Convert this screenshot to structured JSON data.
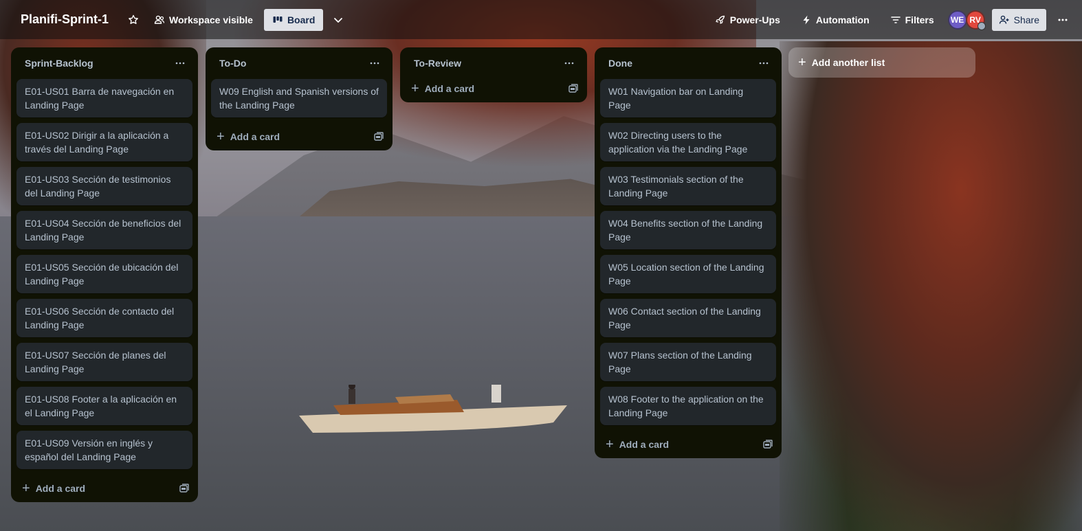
{
  "board": {
    "title": "Planifi-Sprint-1",
    "visibility_label": "Workspace visible",
    "view_label": "Board"
  },
  "topbar": {
    "power_ups_label": "Power-Ups",
    "automation_label": "Automation",
    "filters_label": "Filters",
    "share_label": "Share",
    "members": [
      {
        "initials": "WE",
        "color": "#6e5dc6"
      },
      {
        "initials": "RV",
        "color": "#e2483d"
      }
    ]
  },
  "lists": [
    {
      "title": "Sprint-Backlog",
      "cards": [
        "E01-US01 Barra de navegación en Landing Page",
        "E01-US02 Dirigir a la aplicación a través del Landing Page",
        "E01-US03 Sección de testimonios del Landing Page",
        "E01-US04 Sección de beneficios del Landing Page",
        "E01-US05 Sección de ubicación del Landing Page",
        "E01-US06 Sección de contacto del Landing Page",
        "E01-US07 Sección de planes del Landing Page",
        "E01-US08 Footer a la aplicación en el Landing Page",
        "E01-US09 Versión en inglés y español del Landing Page"
      ],
      "add_card_label": "Add a card"
    },
    {
      "title": "To-Do",
      "cards": [
        "W09 English and Spanish versions of the Landing Page"
      ],
      "add_card_label": "Add a card"
    },
    {
      "title": "To-Review",
      "cards": [],
      "add_card_label": "Add a card"
    },
    {
      "title": "Done",
      "cards": [
        "W01 Navigation bar on Landing Page",
        "W02 Directing users to the application via the Landing Page",
        "W03 Testimonials section of the Landing Page",
        "W04 Benefits section of the Landing Page",
        "W05 Location section of the Landing Page",
        "W06 Contact section of the Landing Page",
        "W07 Plans section of the Landing Page",
        "W08 Footer to the application on the Landing Page"
      ],
      "add_card_label": "Add a card"
    }
  ],
  "add_list_label": "Add another list",
  "icons": {
    "star": "star-icon",
    "visibility": "people-icon",
    "board": "board-icon",
    "view_switch": "chevron-down-icon",
    "power_ups": "rocket-icon",
    "automation": "lightning-icon",
    "filters": "filter-icon",
    "share": "add-person-icon",
    "more": "ellipsis-icon",
    "list_menu": "ellipsis-icon",
    "add": "plus-icon",
    "template": "template-icon"
  }
}
